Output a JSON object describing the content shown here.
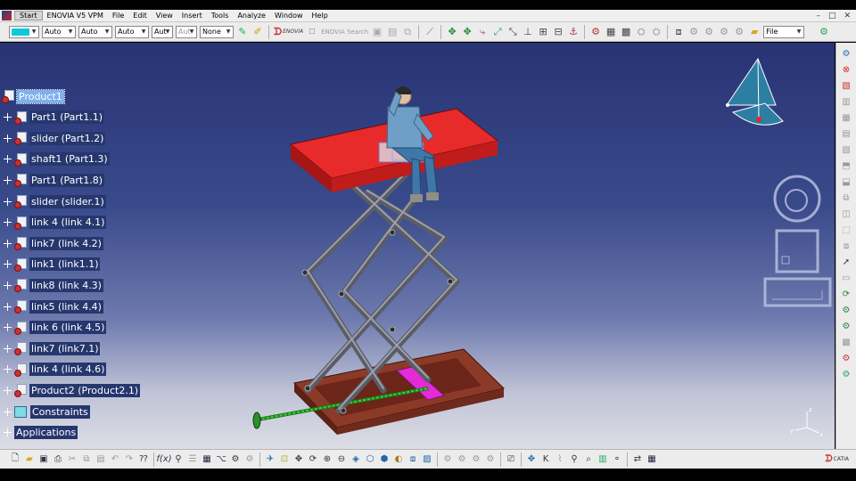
{
  "window": {
    "title": "ENOVIA V5 VPM"
  },
  "menu": {
    "start": "Start",
    "items": [
      "ENOVIA V5 VPM",
      "File",
      "Edit",
      "View",
      "Insert",
      "Tools",
      "Analyze",
      "Window",
      "Help"
    ],
    "controls": [
      "–",
      "□",
      "✕"
    ]
  },
  "toolbar": {
    "color_swatch": "#12c7d9",
    "combos": [
      "Auto",
      "Auto",
      "Auto",
      "Aut",
      "Aut",
      "None"
    ],
    "enovia_label": "ENOVIA",
    "search_label": "ENOVIA Search",
    "file_combo": "File"
  },
  "tree": {
    "root": "Product1",
    "nodes": [
      "Part1 (Part1.1)",
      "slider (Part1.2)",
      "shaft1 (Part1.3)",
      "Part1 (Part1.8)",
      "slider (slider.1)",
      "link 4 (link 4.1)",
      "link7 (link 4.2)",
      "link1 (link1.1)",
      "link8 (link 4.3)",
      "link5 (link 4.4)",
      "link 6 (link 4.5)",
      "link7 (link7.1)",
      "link 4 (link 4.6)",
      "Product2 (Product2.1)"
    ],
    "constraints": "Constraints",
    "applications": "Applications"
  },
  "compass_axis_labels": [
    "x",
    "y",
    "z"
  ],
  "branding": {
    "catia": "CATIA",
    "ds": "3DS"
  },
  "colors": {
    "viewport_top": "#283374",
    "table_top": "#e02424",
    "base_frame": "#7a2f22",
    "slider_block": "#e52ad8",
    "screw": "#2fa82f",
    "tree_label_bg": "#26376e",
    "selected_bg": "#7fb0ec"
  }
}
